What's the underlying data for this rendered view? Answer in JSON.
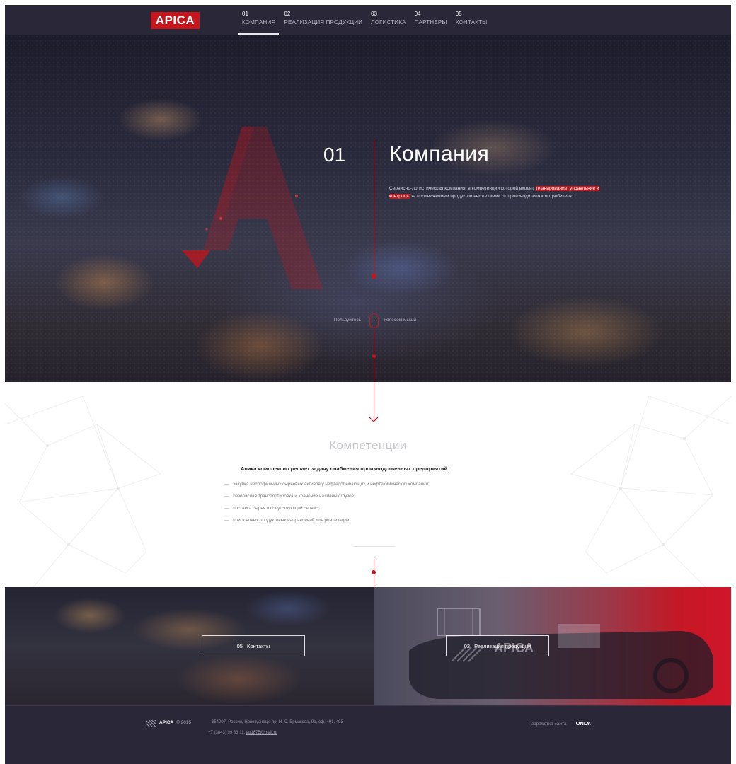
{
  "header": {
    "logo": "APICA",
    "nav": [
      {
        "num": "01",
        "label": "КОМПАНИЯ",
        "active": true
      },
      {
        "num": "02",
        "label": "РЕАЛИЗАЦИЯ ПРОДУКЦИИ",
        "active": false
      },
      {
        "num": "03",
        "label": "ЛОГИСТИКА",
        "active": false
      },
      {
        "num": "04",
        "label": "ПАРТНЕРЫ",
        "active": false
      },
      {
        "num": "05",
        "label": "КОНТАКТЫ",
        "active": false
      }
    ]
  },
  "hero": {
    "num": "01",
    "title": "Компания",
    "text_before": "Сервисно-логистическая компания, в компетенции которой входит",
    "text_highlight": "планирование, управление и контроль",
    "text_after": "за продвижением продуктов нефтехимии от производителя к потребителю.",
    "scroll_left": "Пользуйтесь",
    "scroll_right": "колесом мыши"
  },
  "competencies": {
    "title": "Компетенции",
    "lead": "Апика комплексно решает задачу снабжения производственных предприятий:",
    "items": [
      "закупка непрофильных сырьевых активов у нефтедобывающих и нефтехимических компаний;",
      "безопасная транспортировка и хранение наливных грузов;",
      "поставка сырья и сопутствующий сервис;",
      "поиск новых продуктовых направлений для реализации."
    ]
  },
  "panels": {
    "contacts": {
      "num": "05",
      "label": "Контакты"
    },
    "products": {
      "num": "02",
      "label": "Реализация продукции"
    },
    "tank_text": "APICA"
  },
  "footer": {
    "brand": "APICA",
    "copy": "© 2015",
    "address": "654007, Россия, Новокузнецк, пр. Н. С. Ермакова, 9а, оф. 491, 493",
    "phone": "+7 (3843) 99 33 11,",
    "email": "ap1875@mail.ru",
    "dev_label": "Разработка сайта —",
    "dev_brand": "ONLY."
  },
  "colors": {
    "accent": "#c4161c",
    "dark": "#2a2838",
    "white": "#ffffff"
  }
}
